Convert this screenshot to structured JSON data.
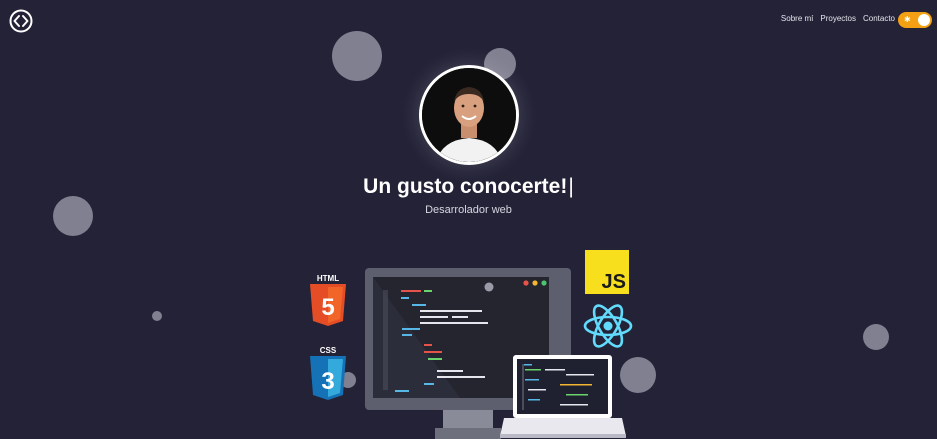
{
  "header": {
    "logo_icon": "code-brackets-icon",
    "nav": [
      {
        "label": "Sobre mí"
      },
      {
        "label": "Proyectos"
      },
      {
        "label": "Contacto"
      }
    ],
    "theme_toggle": {
      "icon": "sun-icon",
      "state": "on",
      "color": "#f4a015"
    }
  },
  "hero": {
    "avatar_alt": "profile-photo",
    "headline": "Un gusto conocerte!",
    "cursor": "|",
    "subtitle": "Desarrolador web"
  },
  "tech_icons": {
    "html": {
      "label": "HTML",
      "glyph": "5",
      "color": "#e44d26"
    },
    "css": {
      "label": "CSS",
      "glyph": "3",
      "color": "#1572b6"
    },
    "js": {
      "label": "JS",
      "color": "#f7df1e"
    },
    "react": {
      "icon": "react-icon",
      "color": "#61dafb"
    }
  },
  "colors": {
    "background": "#232237",
    "accent": "#f4a015"
  }
}
